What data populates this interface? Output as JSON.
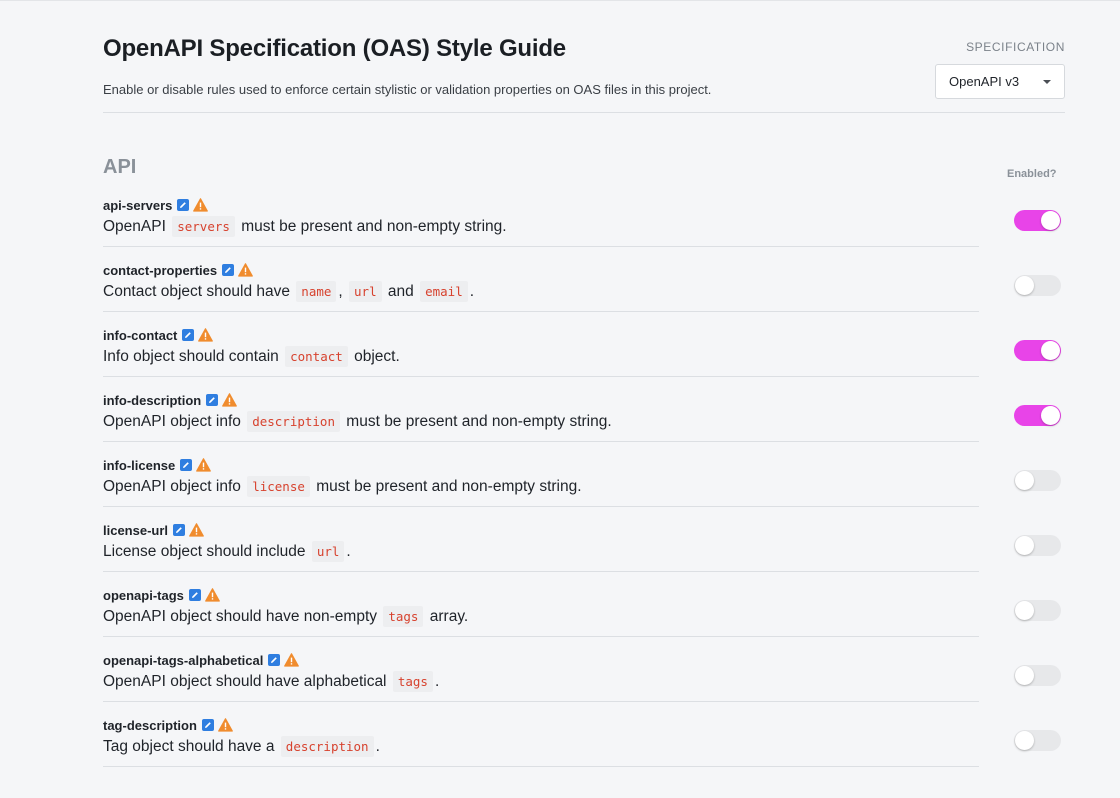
{
  "header": {
    "title": "OpenAPI Specification (OAS) Style Guide",
    "subtitle": "Enable or disable rules used to enforce certain stylistic or validation properties on OAS files in this project."
  },
  "spec": {
    "label": "SPECIFICATION",
    "selected": "OpenAPI v3"
  },
  "section": {
    "title": "API",
    "enabled_label": "Enabled?"
  },
  "colors": {
    "toggle_on": "#e844e8",
    "toggle_off": "#e7e8ea",
    "code_text": "#d7422e",
    "edit_icon": "#2f7ee0",
    "warn_icon": "#f08c2e"
  },
  "icons": {
    "edit": "edit-icon",
    "warning": "warning-icon"
  },
  "rules": [
    {
      "name": "api-servers",
      "enabled": true,
      "desc": [
        {
          "t": "text",
          "v": "OpenAPI"
        },
        {
          "t": "code",
          "v": "servers"
        },
        {
          "t": "text",
          "v": "must be present and non-empty string."
        }
      ]
    },
    {
      "name": "contact-properties",
      "enabled": false,
      "desc": [
        {
          "t": "text",
          "v": "Contact object should have"
        },
        {
          "t": "code",
          "v": "name"
        },
        {
          "t": "text",
          "v": ","
        },
        {
          "t": "code",
          "v": "url"
        },
        {
          "t": "text",
          "v": "and"
        },
        {
          "t": "code",
          "v": "email"
        },
        {
          "t": "text",
          "v": "."
        }
      ]
    },
    {
      "name": "info-contact",
      "enabled": true,
      "desc": [
        {
          "t": "text",
          "v": "Info object should contain"
        },
        {
          "t": "code",
          "v": "contact"
        },
        {
          "t": "text",
          "v": "object."
        }
      ]
    },
    {
      "name": "info-description",
      "enabled": true,
      "desc": [
        {
          "t": "text",
          "v": "OpenAPI object info"
        },
        {
          "t": "code",
          "v": "description"
        },
        {
          "t": "text",
          "v": "must be present and non-empty string."
        }
      ]
    },
    {
      "name": "info-license",
      "enabled": false,
      "desc": [
        {
          "t": "text",
          "v": "OpenAPI object info"
        },
        {
          "t": "code",
          "v": "license"
        },
        {
          "t": "text",
          "v": "must be present and non-empty string."
        }
      ]
    },
    {
      "name": "license-url",
      "enabled": false,
      "desc": [
        {
          "t": "text",
          "v": "License object should include"
        },
        {
          "t": "code",
          "v": "url"
        },
        {
          "t": "text",
          "v": "."
        }
      ]
    },
    {
      "name": "openapi-tags",
      "enabled": false,
      "desc": [
        {
          "t": "text",
          "v": "OpenAPI object should have non-empty"
        },
        {
          "t": "code",
          "v": "tags"
        },
        {
          "t": "text",
          "v": "array."
        }
      ]
    },
    {
      "name": "openapi-tags-alphabetical",
      "enabled": false,
      "desc": [
        {
          "t": "text",
          "v": "OpenAPI object should have alphabetical"
        },
        {
          "t": "code",
          "v": "tags"
        },
        {
          "t": "text",
          "v": "."
        }
      ]
    },
    {
      "name": "tag-description",
      "enabled": false,
      "desc": [
        {
          "t": "text",
          "v": "Tag object should have a"
        },
        {
          "t": "code",
          "v": "description"
        },
        {
          "t": "text",
          "v": "."
        }
      ]
    }
  ]
}
